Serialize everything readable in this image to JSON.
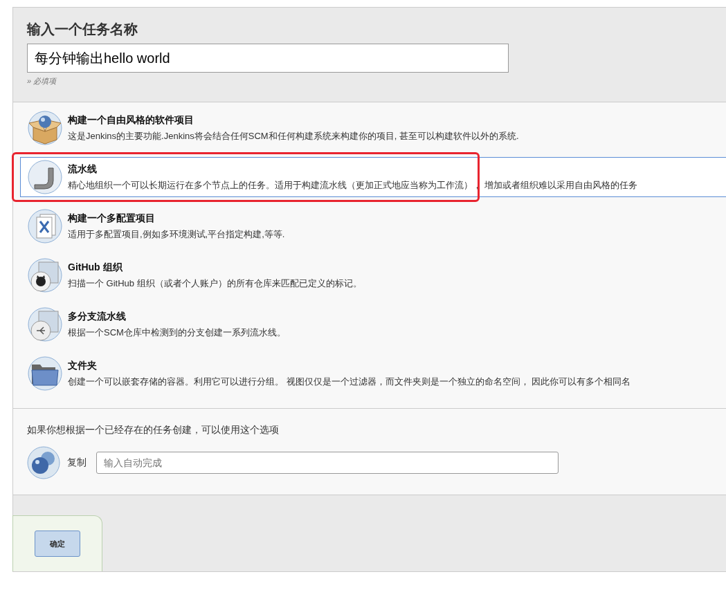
{
  "name_section": {
    "title": "输入一个任务名称",
    "value": "每分钟输出hello world",
    "hint": "» 必填项"
  },
  "item_types": [
    {
      "kind": "freestyle",
      "label": "构建一个自由风格的软件项目",
      "description": "这是Jenkins的主要功能.Jenkins将会结合任何SCM和任何构建系统来构建你的项目, 甚至可以构建软件以外的系统.",
      "selected": false,
      "highlighted": false
    },
    {
      "kind": "pipeline",
      "label": "流水线",
      "description": "精心地组织一个可以长期运行在多个节点上的任务。适用于构建流水线（更加正式地应当称为工作流）， 增加或者组织难以采用自由风格的任务",
      "selected": true,
      "highlighted": true
    },
    {
      "kind": "matrix",
      "label": "构建一个多配置项目",
      "description": "适用于多配置项目,例如多环境测试,平台指定构建,等等.",
      "selected": false,
      "highlighted": false
    },
    {
      "kind": "github",
      "label": "GitHub 组织",
      "description": "扫描一个 GitHub 组织（或者个人账户）的所有仓库来匹配已定义的标记。",
      "selected": false,
      "highlighted": false
    },
    {
      "kind": "multibranch",
      "label": "多分支流水线",
      "description": "根据一个SCM仓库中检测到的分支创建一系列流水线。",
      "selected": false,
      "highlighted": false
    },
    {
      "kind": "folder",
      "label": "文件夹",
      "description": "创建一个可以嵌套存储的容器。利用它可以进行分组。 视图仅仅是一个过滤器，而文件夹则是一个独立的命名空间， 因此你可以有多个相同名",
      "selected": false,
      "highlighted": false
    }
  ],
  "copy_section": {
    "text": "如果你想根据一个已经存在的任务创建，可以使用这个选项",
    "label": "复制",
    "placeholder": "输入自动完成"
  },
  "ok_button": "确定"
}
